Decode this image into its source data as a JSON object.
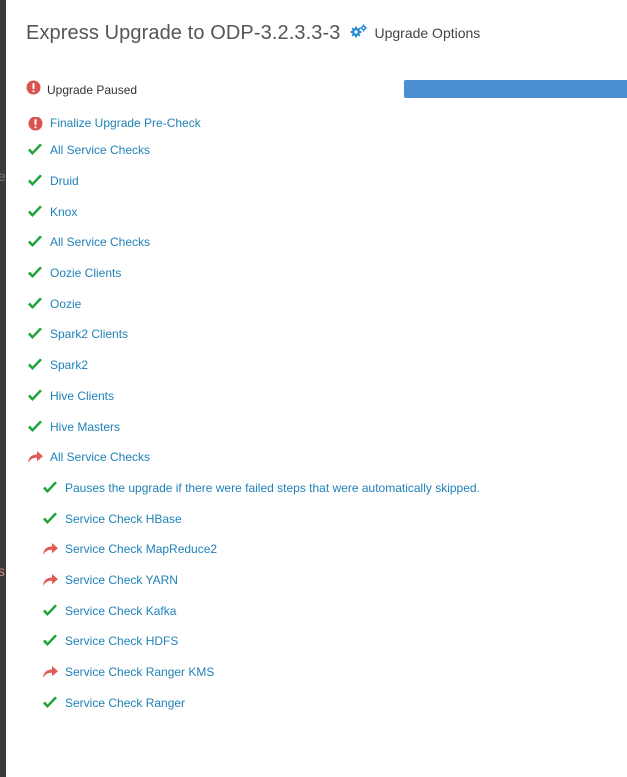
{
  "header": {
    "title": "Express Upgrade to ODP-3.2.3.3-3",
    "options_label": "Upgrade Options"
  },
  "status": {
    "text": "Upgrade Paused",
    "progress_fraction": 0.98
  },
  "tasks": [
    {
      "label": "Finalize Upgrade Pre-Check",
      "state": "paused",
      "indent": 0
    },
    {
      "label": "All Service Checks",
      "state": "done",
      "indent": 0
    },
    {
      "label": "Druid",
      "state": "done",
      "indent": 0
    },
    {
      "label": "Knox",
      "state": "done",
      "indent": 0
    },
    {
      "label": "All Service Checks",
      "state": "done",
      "indent": 0
    },
    {
      "label": "Oozie Clients",
      "state": "done",
      "indent": 0
    },
    {
      "label": "Oozie",
      "state": "done",
      "indent": 0
    },
    {
      "label": "Spark2 Clients",
      "state": "done",
      "indent": 0
    },
    {
      "label": "Spark2",
      "state": "done",
      "indent": 0
    },
    {
      "label": "Hive Clients",
      "state": "done",
      "indent": 0
    },
    {
      "label": "Hive Masters",
      "state": "done",
      "indent": 0
    },
    {
      "label": "All Service Checks",
      "state": "skipped",
      "indent": 0
    },
    {
      "label": "Pauses the upgrade if there were failed steps that were automatically skipped.",
      "state": "done",
      "indent": 1
    },
    {
      "label": "Service Check HBase",
      "state": "done",
      "indent": 1
    },
    {
      "label": "Service Check MapReduce2",
      "state": "skipped",
      "indent": 1
    },
    {
      "label": "Service Check YARN",
      "state": "skipped",
      "indent": 1
    },
    {
      "label": "Service Check Kafka",
      "state": "done",
      "indent": 1
    },
    {
      "label": "Service Check HDFS",
      "state": "done",
      "indent": 1
    },
    {
      "label": "Service Check Ranger KMS",
      "state": "skipped",
      "indent": 1
    },
    {
      "label": "Service Check Ranger",
      "state": "done",
      "indent": 1
    }
  ],
  "left_strip_chars": [
    {
      "char": "e",
      "tone": "gray"
    },
    {
      "char": "s",
      "tone": "red"
    }
  ],
  "colors": {
    "link": "#1f82b8",
    "done": "#1ea53a",
    "skipped": "#e05c56",
    "paused": "#d9534f",
    "progress": "#4a8fd1",
    "options_icon": "#2a8fd6"
  }
}
